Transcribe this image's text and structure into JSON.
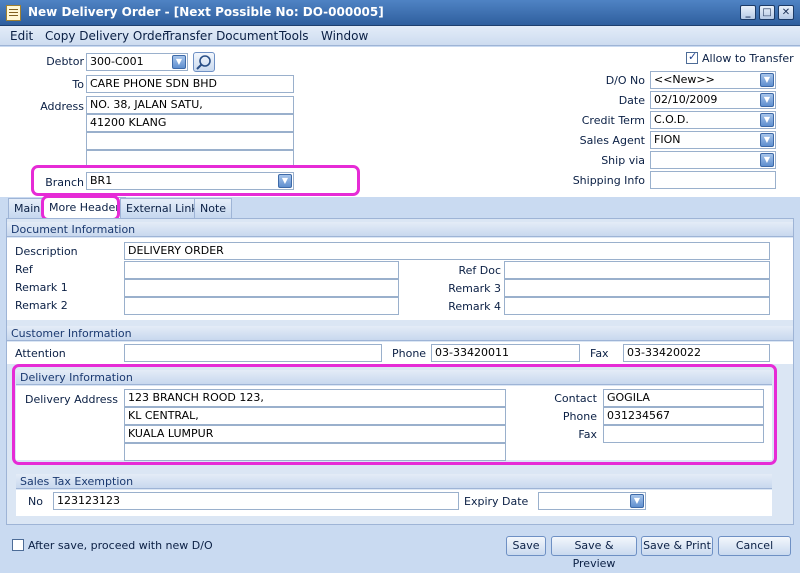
{
  "window": {
    "title": "New Delivery Order - [Next Possible No: DO-000005]",
    "min_glyph": "_",
    "max_glyph": "□",
    "close_glyph": "✕"
  },
  "menu": [
    "Edit",
    "Copy Delivery Order",
    "Transfer Document",
    "Tools",
    "Window"
  ],
  "header": {
    "debtor_label": "Debtor",
    "debtor_value": "300-C001",
    "to_label": "To",
    "to_value": "CARE PHONE SDN BHD",
    "address_label": "Address",
    "address_lines": [
      "NO. 38, JALAN SATU,",
      "41200 KLANG",
      "",
      ""
    ],
    "branch_label": "Branch",
    "branch_value": "BR1",
    "allow_transfer_label": "Allow to Transfer",
    "allow_transfer_checked": true,
    "do_no_label": "D/O No",
    "do_no_value": "<<New>>",
    "date_label": "Date",
    "date_value": "02/10/2009",
    "credit_term_label": "Credit Term",
    "credit_term_value": "C.O.D.",
    "sales_agent_label": "Sales Agent",
    "sales_agent_value": "FION",
    "ship_via_label": "Ship via",
    "ship_via_value": "",
    "shipping_info_label": "Shipping Info",
    "shipping_info_value": ""
  },
  "tabs": [
    "Main",
    "More Header",
    "External Link",
    "Note"
  ],
  "active_tab": "More Header",
  "document_info": {
    "title": "Document Information",
    "description_label": "Description",
    "description_value": "DELIVERY ORDER",
    "ref_label": "Ref",
    "ref_value": "",
    "remark1_label": "Remark 1",
    "remark1_value": "",
    "remark2_label": "Remark 2",
    "remark2_value": "",
    "ref_doc_label": "Ref Doc",
    "ref_doc_value": "",
    "remark3_label": "Remark 3",
    "remark3_value": "",
    "remark4_label": "Remark 4",
    "remark4_value": ""
  },
  "customer_info": {
    "title": "Customer Information",
    "attention_label": "Attention",
    "attention_value": "",
    "phone_label": "Phone",
    "phone_value": "03-33420011",
    "fax_label": "Fax",
    "fax_value": "03-33420022"
  },
  "delivery_info": {
    "title": "Delivery Information",
    "address_label": "Delivery Address",
    "address_lines": [
      "123 BRANCH ROOD 123,",
      "KL CENTRAL,",
      "KUALA LUMPUR",
      ""
    ],
    "contact_label": "Contact",
    "contact_value": "GOGILA",
    "phone_label": "Phone",
    "phone_value": "031234567",
    "fax_label": "Fax",
    "fax_value": ""
  },
  "tax_exemption": {
    "title": "Sales Tax Exemption",
    "no_label": "No",
    "no_value": "123123123",
    "expiry_label": "Expiry Date",
    "expiry_value": ""
  },
  "footer": {
    "proceed_label": "After save, proceed with new D/O",
    "proceed_checked": false,
    "save_label": "Save",
    "save_preview_label": "Save & Preview",
    "save_print_label": "Save & Print",
    "cancel_label": "Cancel"
  },
  "colors": {
    "highlight": "#e62bd6",
    "title_bar": "#3a6aa8",
    "panel_bg": "#dbe6f4"
  }
}
